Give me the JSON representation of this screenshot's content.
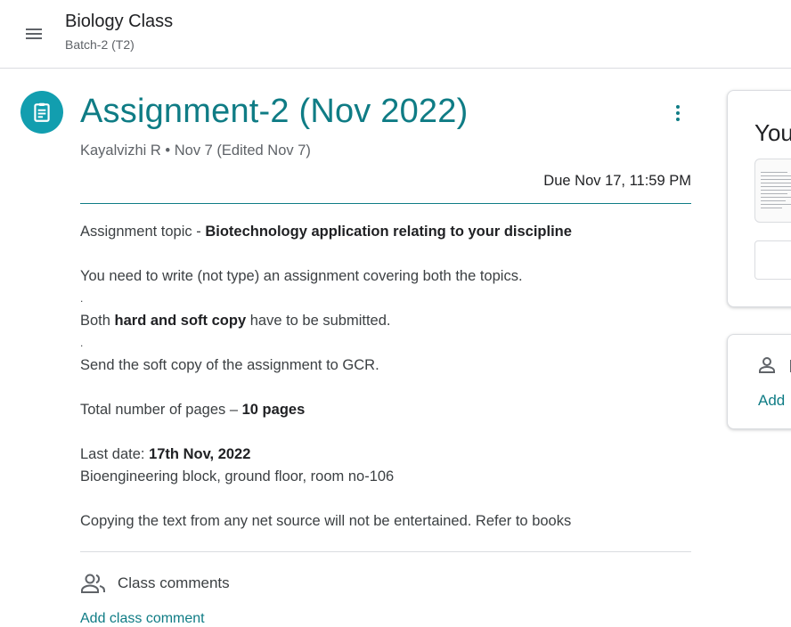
{
  "header": {
    "class_title": "Biology Class",
    "class_subtitle": "Batch-2 (T2)"
  },
  "assignment": {
    "title": "Assignment-2 (Nov 2022)",
    "meta": "Kayalvizhi R • Nov 7 (Edited Nov 7)",
    "due": "Due Nov 17, 11:59 PM",
    "topic_prefix": "Assignment topic - ",
    "topic_bold": "Biotechnology  application relating to your discipline",
    "line_write": "You need to write (not type) an assignment covering both the topics.",
    "dot1": ".",
    "both_prefix": "Both ",
    "both_bold": "hard and soft copy",
    "both_suffix": " have to be submitted.",
    "dot2": ".",
    "line_send": "Send the soft copy  of the assignment to GCR.",
    "pages_prefix": "Total number of pages – ",
    "pages_bold": "10 pages",
    "last_prefix": "Last date: ",
    "last_bold": "17th Nov, 2022",
    "location": "Bioengineering block, ground floor, room no-106",
    "copying": "Copying the text from any net source will not be entertained. Refer to books"
  },
  "comments": {
    "label": "Class comments",
    "add_link": "Add class comment"
  },
  "side": {
    "work_title": "You",
    "private_add": "Add"
  },
  "colors": {
    "accent": "#0f7c85",
    "icon_bg": "#129eaf"
  },
  "icons": {
    "menu": "hamburger-menu-icon",
    "assignment": "assignment-clipboard-icon",
    "more": "more-vertical-icon",
    "comments": "people-icon",
    "private": "person-icon"
  }
}
